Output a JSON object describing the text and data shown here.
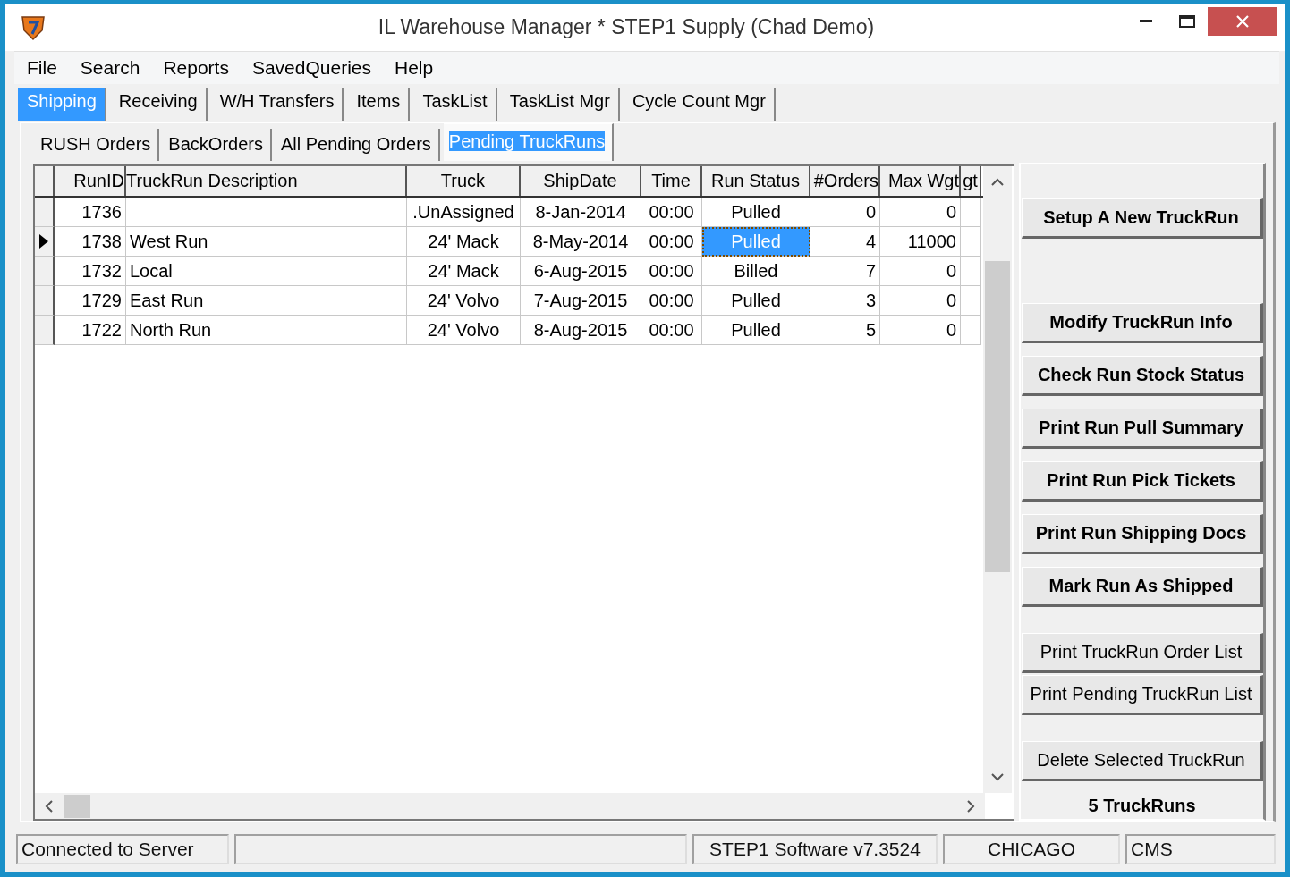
{
  "window": {
    "title": "IL Warehouse Manager * STEP1 Supply (Chad Demo)"
  },
  "menu": [
    "File",
    "Search",
    "Reports",
    "SavedQueries",
    "Help"
  ],
  "tabs": [
    {
      "label": "Shipping",
      "selected": true
    },
    {
      "label": "Receiving",
      "selected": false
    },
    {
      "label": "W/H Transfers",
      "selected": false
    },
    {
      "label": "Items",
      "selected": false
    },
    {
      "label": "TaskList",
      "selected": false
    },
    {
      "label": "TaskList Mgr",
      "selected": false
    },
    {
      "label": "Cycle Count Mgr",
      "selected": false
    }
  ],
  "subtabs": [
    {
      "label": "RUSH Orders",
      "selected": false
    },
    {
      "label": "BackOrders",
      "selected": false
    },
    {
      "label": "All Pending Orders",
      "selected": false
    },
    {
      "label": "Pending TruckRuns",
      "selected": true
    }
  ],
  "table": {
    "columns": [
      "RunID",
      "TruckRun Description",
      "Truck",
      "ShipDate",
      "Time",
      "Run Status",
      "#Orders",
      "Max Wgt",
      "gt"
    ],
    "rows": [
      {
        "selected": false,
        "status_focused": false,
        "cells": [
          "1736",
          null,
          ".UnAssigned",
          "8-Jan-2014",
          "00:00",
          "Pulled",
          "0",
          "0",
          null
        ]
      },
      {
        "selected": true,
        "status_focused": true,
        "cells": [
          "1738",
          "West Run",
          "24' Mack",
          "8-May-2014",
          "00:00",
          "Pulled",
          "4",
          "11000",
          null
        ]
      },
      {
        "selected": false,
        "status_focused": false,
        "cells": [
          "1732",
          "Local",
          "24' Mack",
          "6-Aug-2015",
          "00:00",
          "Billed",
          "7",
          "0",
          null
        ]
      },
      {
        "selected": false,
        "status_focused": false,
        "cells": [
          "1729",
          "East Run",
          "24' Volvo",
          "7-Aug-2015",
          "00:00",
          "Pulled",
          "3",
          "0",
          null
        ]
      },
      {
        "selected": false,
        "status_focused": false,
        "cells": [
          "1722",
          "North Run",
          "24' Volvo",
          "8-Aug-2015",
          "00:00",
          "Pulled",
          "5",
          "0",
          null
        ]
      }
    ]
  },
  "button_groups": [
    [
      {
        "label": "Setup A New TruckRun",
        "kind": "action"
      }
    ],
    [
      {
        "label": "Modify TruckRun Info",
        "kind": "action"
      },
      {
        "label": "Check Run Stock Status",
        "kind": "action"
      },
      {
        "label": "Print Run Pull Summary",
        "kind": "action"
      },
      {
        "label": "Print Run Pick Tickets",
        "kind": "action"
      },
      {
        "label": "Print Run Shipping Docs",
        "kind": "action"
      },
      {
        "label": "Mark Run As Shipped",
        "kind": "action"
      }
    ],
    [
      {
        "label": "Print TruckRun Order List",
        "kind": "report"
      },
      {
        "label": "Print Pending TruckRun List",
        "kind": "report"
      }
    ],
    [
      {
        "label": "Delete Selected TruckRun",
        "kind": "report"
      }
    ]
  ],
  "count_label": "5 TruckRuns",
  "status_bar": [
    "Connected to Server",
    "STEP1 Software v7.3524",
    "CHICAGO",
    "CMS"
  ]
}
